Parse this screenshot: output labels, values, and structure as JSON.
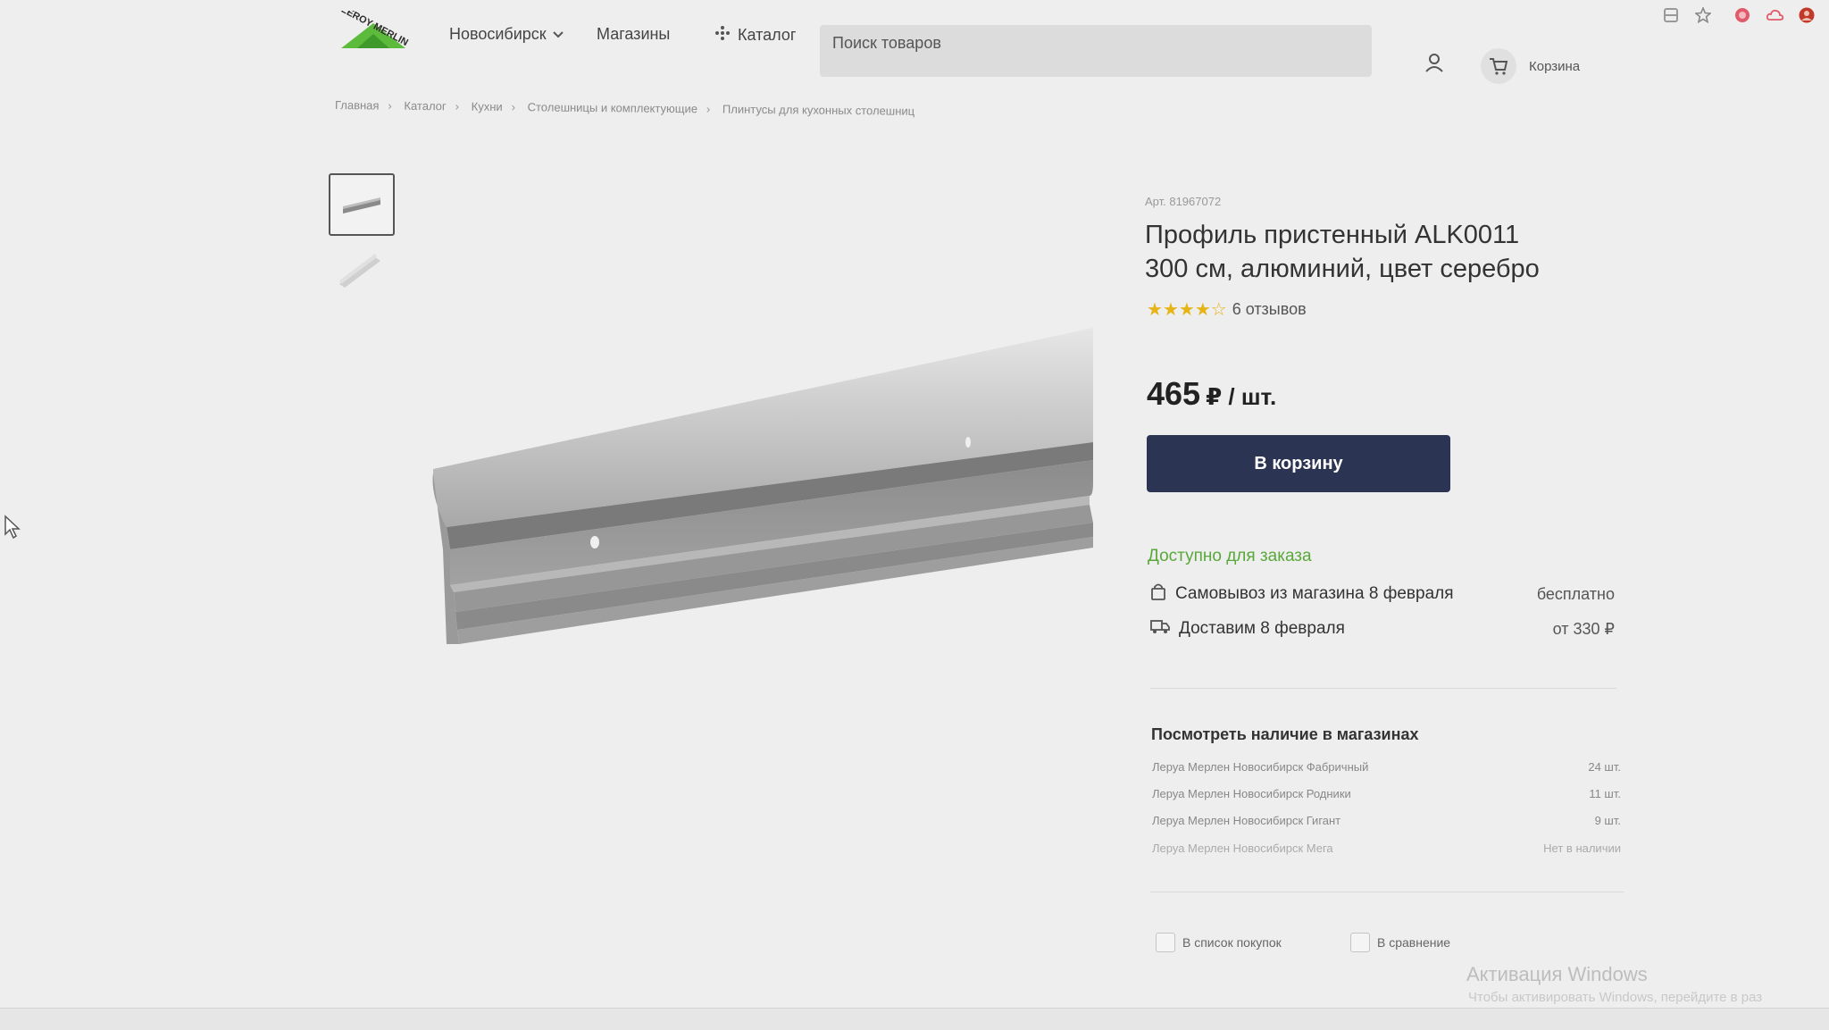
{
  "header": {
    "logo_text": "LEROY MERLIN",
    "city": "Новосибирск",
    "stores": "Магазины",
    "catalog": "Каталог",
    "search_placeholder": "Поиск товаров",
    "cart_label": "Корзина"
  },
  "breadcrumb": [
    "Главная",
    "Каталог",
    "Кухни",
    "Столешницы и комплектующие",
    "Плинтусы для кухонных столешниц"
  ],
  "product": {
    "article": "Арт. 81967072",
    "title_line1": "Профиль пристенный ALK0011",
    "title_line2": "300 см, алюминий, цвет серебро",
    "rating": 4,
    "rating_max": 5,
    "reviews": "6 отзывов",
    "price": "465",
    "price_unit": "₽ / шт.",
    "buy_button": "В корзину"
  },
  "availability": {
    "status": "Доступно для заказа",
    "pickup_label": "Самовывоз из магазина 8 февраля",
    "pickup_price": "бесплатно",
    "delivery_label": "Доставим 8 февраля",
    "delivery_price": "от 330 ₽"
  },
  "stores_stock": {
    "title": "Посмотреть наличие в магазинах",
    "rows": [
      {
        "name": "Леруа Мерлен Новосибирск Фабричный",
        "qty": "24 шт."
      },
      {
        "name": "Леруа Мерлен Новосибирск Родники",
        "qty": "11 шт."
      },
      {
        "name": "Леруа Мерлен Новосибирск Гигант",
        "qty": "9 шт."
      },
      {
        "name": "Леруа Мерлен Новосибирск Мега",
        "qty": "Нет в наличии"
      }
    ]
  },
  "actions": {
    "shopping_list": "В список покупок",
    "compare": "В сравнение"
  },
  "watermark": {
    "title": "Активация Windows",
    "subtitle": "Чтобы активировать Windows, перейдите в раз"
  },
  "colors": {
    "accent_green": "#58a83a",
    "button_dark": "#2b3452",
    "star": "#e7b416"
  }
}
